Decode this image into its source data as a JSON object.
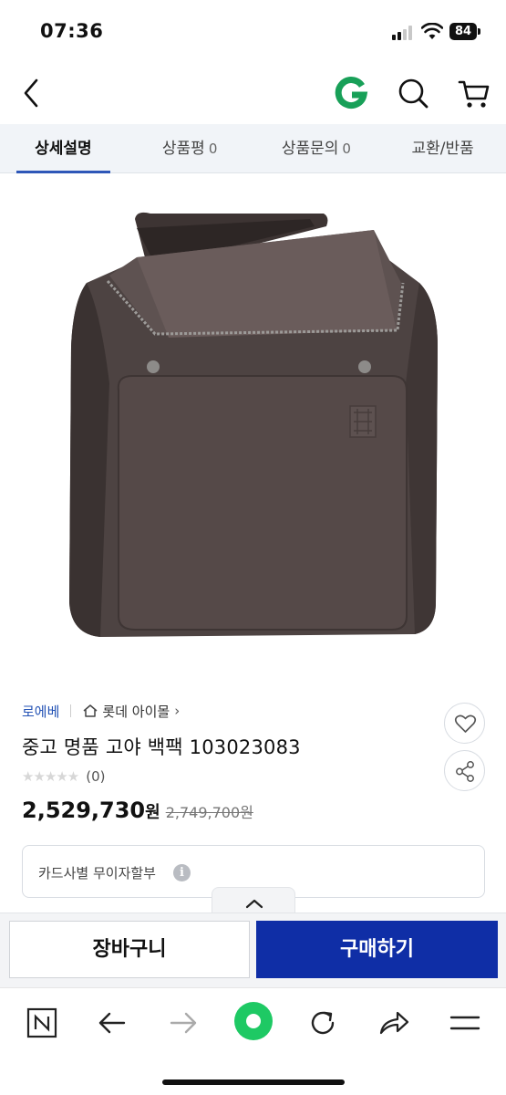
{
  "status_bar": {
    "time": "07:36",
    "battery": "84"
  },
  "header": {
    "icons": [
      "back-icon",
      "g-logo-icon",
      "search-icon",
      "cart-icon"
    ],
    "logo_color": "#18a058"
  },
  "tabs": [
    {
      "label": "상세설명",
      "count": "",
      "active": true
    },
    {
      "label": "상품평",
      "count": "0",
      "active": false
    },
    {
      "label": "상품문의",
      "count": "0",
      "active": false
    },
    {
      "label": "교환/반품",
      "count": "",
      "active": false
    }
  ],
  "product": {
    "brand": "로에베",
    "store": "롯데 아이몰",
    "title": "중고 명품 고야 백팩 103023083",
    "rating_count": "(0)",
    "stars": "★★★★★",
    "price": "2,529,730",
    "price_unit": "원",
    "original_price": "2,749,700원",
    "card_installment": "카드사별 무이자할부",
    "info_icon": "i"
  },
  "purchase_bar": {
    "cart_label": "장바구니",
    "buy_label": "구매하기",
    "buy_color": "#0f2ea6"
  },
  "browser_bar": {
    "icons": [
      "naver-n-icon",
      "back-arrow-icon",
      "forward-arrow-icon",
      "green-dot-icon",
      "refresh-icon",
      "share-arrow-icon",
      "menu-icon"
    ],
    "home_color": "#1ec964"
  },
  "colors": {
    "accent": "#2e57b8",
    "tab_bg": "#f1f4f8"
  }
}
